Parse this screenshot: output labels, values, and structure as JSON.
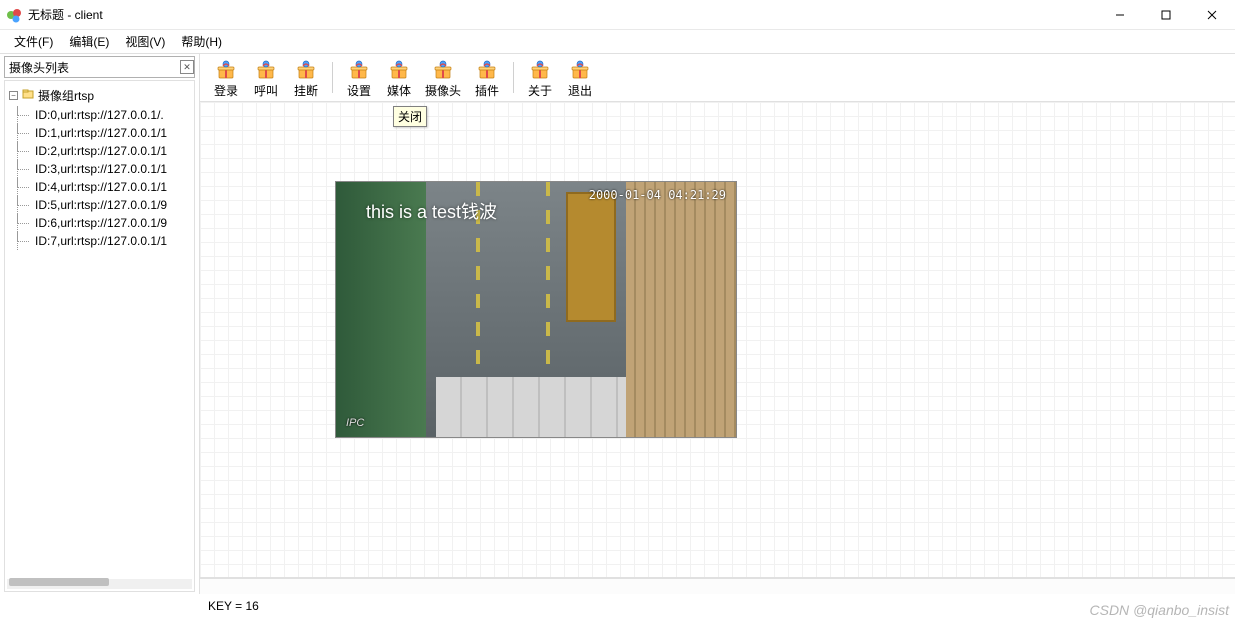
{
  "window": {
    "title": "无标题 - client"
  },
  "menu": {
    "file": "文件(F)",
    "edit": "编辑(E)",
    "view": "视图(V)",
    "help": "帮助(H)"
  },
  "left_panel": {
    "header": "摄像头列表",
    "root": "摄像组rtsp",
    "items": [
      "ID:0,url:rtsp://127.0.0.1/.",
      "ID:1,url:rtsp://127.0.0.1/1",
      "ID:2,url:rtsp://127.0.0.1/1",
      "ID:3,url:rtsp://127.0.0.1/1",
      "ID:4,url:rtsp://127.0.0.1/1",
      "ID:5,url:rtsp://127.0.0.1/9",
      "ID:6,url:rtsp://127.0.0.1/9",
      "ID:7,url:rtsp://127.0.0.1/1"
    ]
  },
  "toolbar": {
    "groups": [
      [
        "登录",
        "呼叫",
        "挂断"
      ],
      [
        "设置",
        "媒体",
        "摄像头",
        "插件"
      ],
      [
        "关于",
        "退出"
      ]
    ]
  },
  "tooltip": {
    "close": "关闭"
  },
  "video": {
    "overlay_text": "this is a test钱波",
    "timestamp": "2000-01-04 04:21:29",
    "corner_label": "IPC"
  },
  "statusbar": {
    "key": "KEY = 16"
  },
  "watermark": "CSDN @qianbo_insist"
}
